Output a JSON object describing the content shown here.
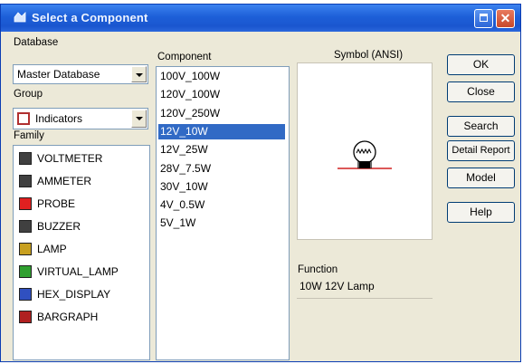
{
  "window": {
    "title": "Select a Component"
  },
  "labels": {
    "database": "Database",
    "group": "Group",
    "family": "Family",
    "component": "Component",
    "symbol": "Symbol (ANSI)",
    "function": "Function"
  },
  "database": {
    "selected": "Master Database"
  },
  "group": {
    "selected": "Indicators"
  },
  "families": [
    {
      "label": "VOLTMETER",
      "icon": "voltmeter-icon",
      "color": "#404040"
    },
    {
      "label": "AMMETER",
      "icon": "ammeter-icon",
      "color": "#404040"
    },
    {
      "label": "PROBE",
      "icon": "probe-icon",
      "color": "#e02020"
    },
    {
      "label": "BUZZER",
      "icon": "buzzer-icon",
      "color": "#404040"
    },
    {
      "label": "LAMP",
      "icon": "lamp-icon",
      "color": "#c8a020"
    },
    {
      "label": "VIRTUAL_LAMP",
      "icon": "virtual-lamp-icon",
      "color": "#30a030"
    },
    {
      "label": "HEX_DISPLAY",
      "icon": "hex-display-icon",
      "color": "#3050c0"
    },
    {
      "label": "BARGRAPH",
      "icon": "bargraph-icon",
      "color": "#b02020"
    }
  ],
  "components": [
    {
      "label": "100V_100W",
      "selected": false
    },
    {
      "label": "120V_100W",
      "selected": false
    },
    {
      "label": "120V_250W",
      "selected": false
    },
    {
      "label": "12V_10W",
      "selected": true
    },
    {
      "label": "12V_25W",
      "selected": false
    },
    {
      "label": "28V_7.5W",
      "selected": false
    },
    {
      "label": "30V_10W",
      "selected": false
    },
    {
      "label": "4V_0.5W",
      "selected": false
    },
    {
      "label": "5V_1W",
      "selected": false
    }
  ],
  "function_text": "10W 12V Lamp",
  "buttons": {
    "ok": "OK",
    "close": "Close",
    "search": "Search",
    "detail_report": "Detail Report",
    "model": "Model",
    "help": "Help"
  },
  "colors": {
    "titlebar": "#1d5fd8",
    "selection": "#316ac5",
    "dialog_bg": "#ece9d8"
  }
}
